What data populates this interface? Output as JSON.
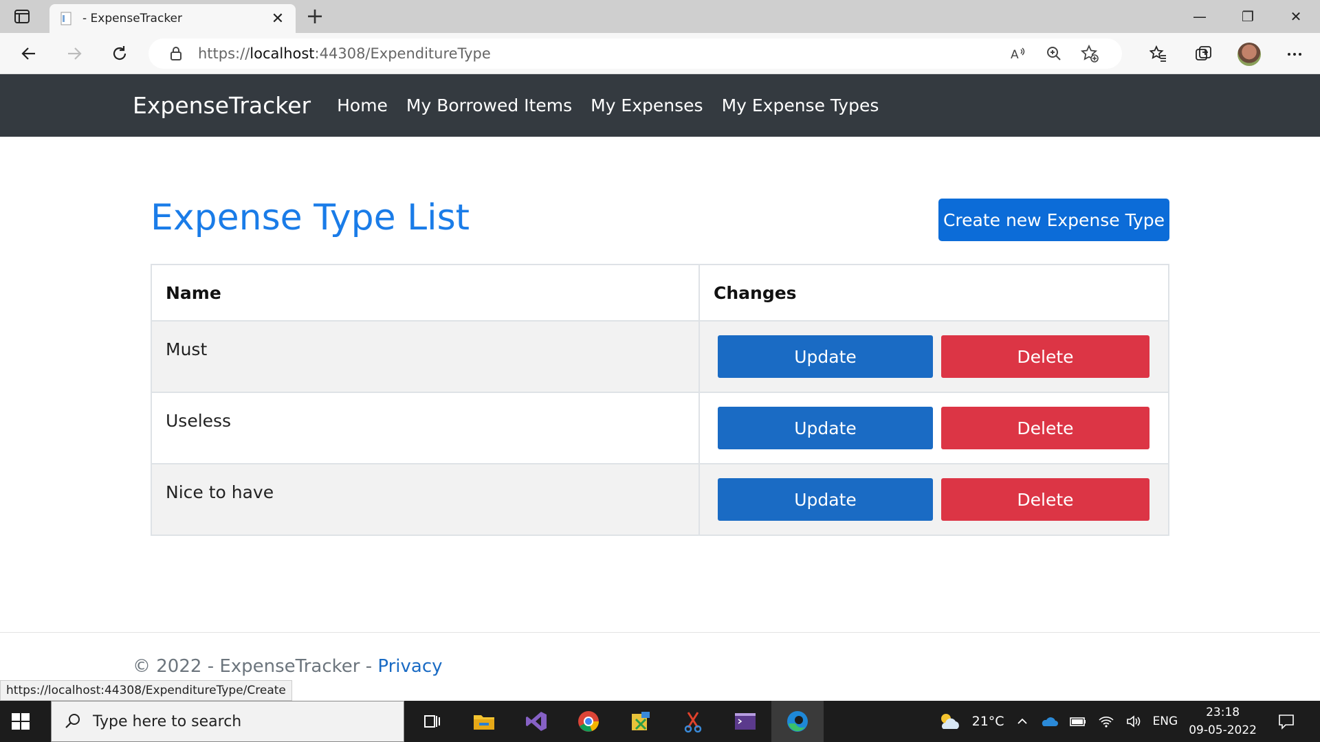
{
  "browser": {
    "tab_title": "- ExpenseTracker",
    "url_prefix": "https://",
    "url_host": "localhost",
    "url_rest": ":44308/ExpenditureType",
    "status_url": "https://localhost:44308/ExpenditureType/Create"
  },
  "navbar": {
    "brand": "ExpenseTracker",
    "links": [
      "Home",
      "My Borrowed Items",
      "My Expenses",
      "My Expense Types"
    ]
  },
  "page": {
    "title": "Expense Type List",
    "create_button": "Create new Expense Type"
  },
  "table": {
    "headers": [
      "Name",
      "Changes"
    ],
    "rows": [
      {
        "name": "Must",
        "update": "Update",
        "delete": "Delete"
      },
      {
        "name": "Useless",
        "update": "Update",
        "delete": "Delete"
      },
      {
        "name": "Nice to have",
        "update": "Update",
        "delete": "Delete"
      }
    ]
  },
  "footer": {
    "text": "© 2022 - ExpenseTracker - ",
    "privacy": "Privacy"
  },
  "taskbar": {
    "search_placeholder": "Type here to search",
    "temperature": "21°C",
    "language": "ENG",
    "time": "23:18",
    "date": "09-05-2022"
  },
  "colors": {
    "primary": "#0c6cd8",
    "title": "#1a7ce8",
    "danger": "#dc3545",
    "navbar": "#343a40"
  }
}
